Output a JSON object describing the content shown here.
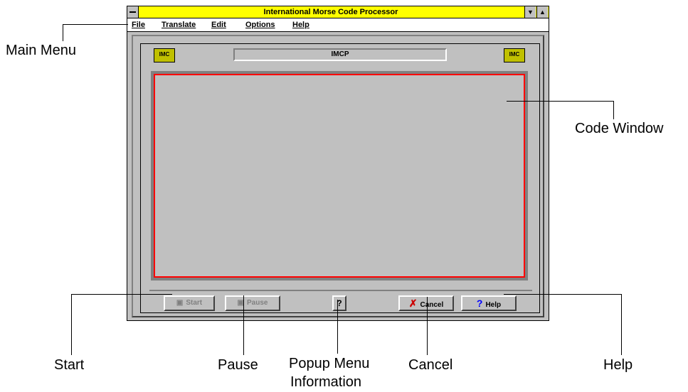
{
  "window": {
    "title": "International Morse Code Processor",
    "menu": [
      "File",
      "Translate",
      "Edit",
      "Options",
      "Help"
    ],
    "label": "IMCP",
    "logo_text": "IMC"
  },
  "buttons": {
    "start": "Start",
    "pause": "Pause",
    "popup": "?",
    "cancel": "Cancel",
    "help": "Help"
  },
  "callouts": {
    "main_menu": "Main Menu",
    "code_window": "Code Window",
    "start": "Start",
    "pause": "Pause",
    "popup_menu_line1": "Popup Menu",
    "popup_menu_line2": "Information",
    "cancel": "Cancel",
    "help": "Help"
  },
  "colors": {
    "titlebar": "#ffff00",
    "code_window_border": "#ff0000",
    "cancel_icon": "#cc0000",
    "help_icon": "#0000ff"
  }
}
